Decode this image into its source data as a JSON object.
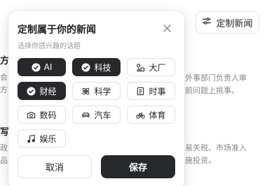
{
  "header": {
    "customize_button_label": "定制新闻"
  },
  "background": {
    "left_fragments": [
      "方",
      "会",
      "方",
      "写",
      "政",
      "品"
    ],
    "right_lines": [
      "外事部门负责人审",
      "前问题上挑事。",
      "易关税、市场准入",
      "施投资。"
    ]
  },
  "popover": {
    "title": "定制属于你的新闻",
    "subtitle": "选择你感兴趣的话题",
    "topics": [
      {
        "label": "AI",
        "icon": "check-circle-icon",
        "selected": true
      },
      {
        "label": "科技",
        "icon": "check-circle-icon",
        "selected": true
      },
      {
        "label": "大厂",
        "icon": "shapes-icon",
        "selected": false
      },
      {
        "label": "财经",
        "icon": "check-circle-icon",
        "selected": true
      },
      {
        "label": "科学",
        "icon": "atom-icon",
        "selected": false
      },
      {
        "label": "时事",
        "icon": "document-icon",
        "selected": false
      },
      {
        "label": "数码",
        "icon": "camera-icon",
        "selected": false
      },
      {
        "label": "汽车",
        "icon": "car-icon",
        "selected": false
      },
      {
        "label": "体育",
        "icon": "bike-icon",
        "selected": false
      },
      {
        "label": "娱乐",
        "icon": "music-icon",
        "selected": false
      }
    ],
    "cancel_label": "取消",
    "save_label": "保存"
  },
  "colors": {
    "selected_chip_bg": "#27282c",
    "chip_border": "#e2e2e2",
    "subtitle": "#999999"
  }
}
